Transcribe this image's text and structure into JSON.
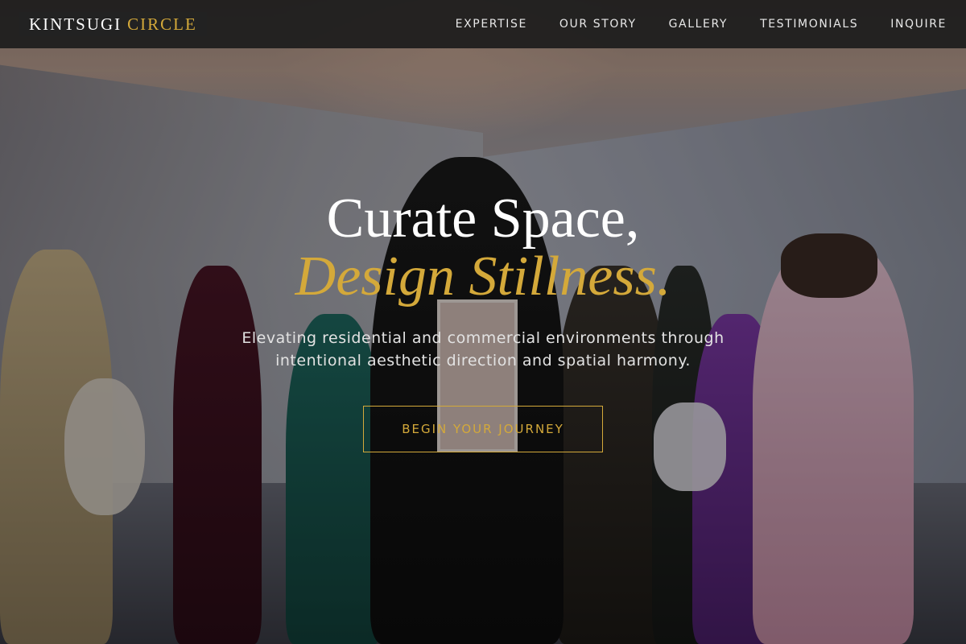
{
  "brand": {
    "name_part1": "KINTSUGI",
    "name_part2": "CIRCLE",
    "accent_color": "#d4a93a"
  },
  "nav": {
    "items": [
      {
        "label": "EXPERTISE"
      },
      {
        "label": "OUR STORY"
      },
      {
        "label": "GALLERY"
      },
      {
        "label": "TESTIMONIALS"
      },
      {
        "label": "INQUIRE"
      }
    ]
  },
  "hero": {
    "headline_line1": "Curate Space,",
    "headline_line2": "Design Stillness.",
    "subtitle": "Elevating residential and commercial environments through intentional aesthetic direction and spatial harmony.",
    "cta_label": "BEGIN YOUR JOURNEY",
    "background_description_icon": "hero-photo-group-of-people"
  }
}
